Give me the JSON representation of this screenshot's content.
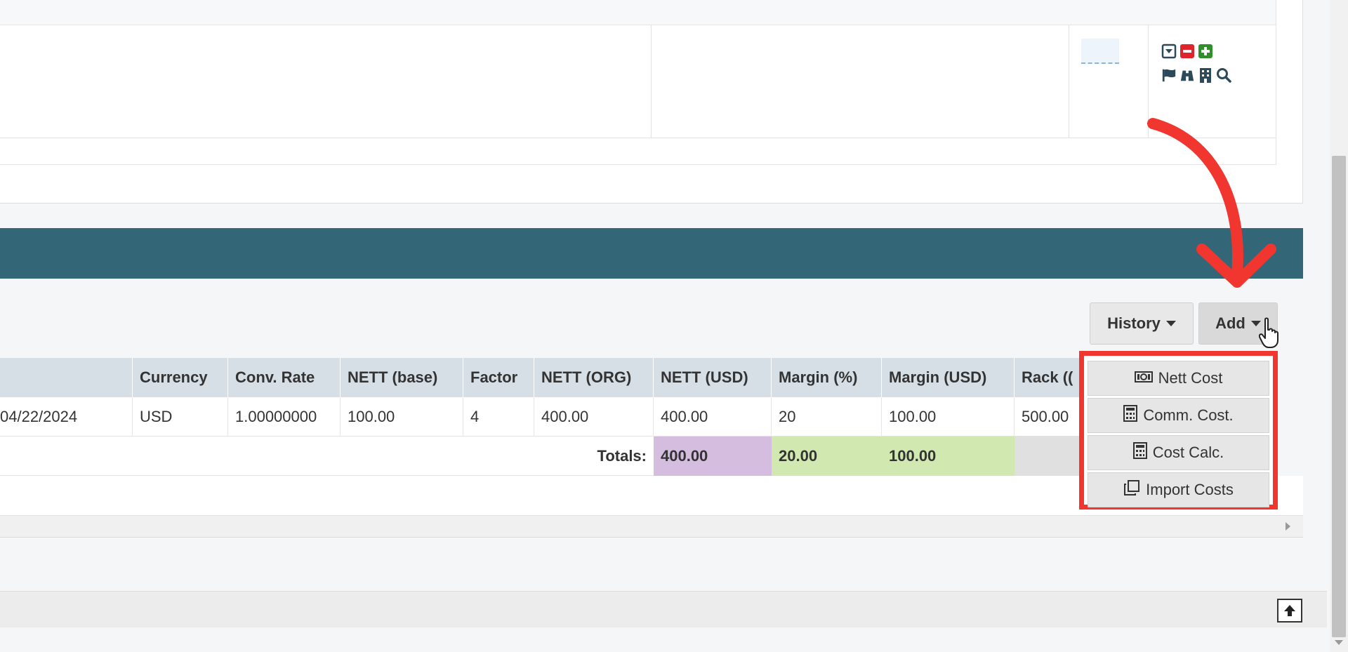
{
  "toolbar": {
    "history_label": "History",
    "add_label": "Add"
  },
  "add_menu": {
    "items": [
      {
        "label": "Nett Cost",
        "icon": "money-icon"
      },
      {
        "label": "Comm. Cost.",
        "icon": "calculator-icon"
      },
      {
        "label": "Cost Calc.",
        "icon": "calculator-icon"
      },
      {
        "label": "Import Costs",
        "icon": "copy-icon"
      }
    ]
  },
  "row_icons": [
    "dropdown-square-icon",
    "minus-square-icon",
    "plus-square-icon",
    "flag-icon",
    "binoculars-icon",
    "building-icon",
    "search-icon"
  ],
  "grid": {
    "headers": [
      "",
      "Currency",
      "Conv. Rate",
      "NETT (base)",
      "Factor",
      "NETT (ORG)",
      "NETT (USD)",
      "Margin (%)",
      "Margin (USD)",
      "Rack (("
    ],
    "row": [
      "04/22/2024",
      "USD",
      "1.00000000",
      "100.00",
      "4",
      "400.00",
      "400.00",
      "20",
      "100.00",
      "500.00"
    ],
    "totals_label": "Totals:",
    "totals": {
      "nett_usd": "400.00",
      "margin_pct": "20.00",
      "margin_usd": "100.00"
    }
  },
  "colors": {
    "header_bar": "#336677",
    "highlight": "#f0362f",
    "total_purple": "#d5bde0",
    "total_green": "#d1e8b0"
  }
}
